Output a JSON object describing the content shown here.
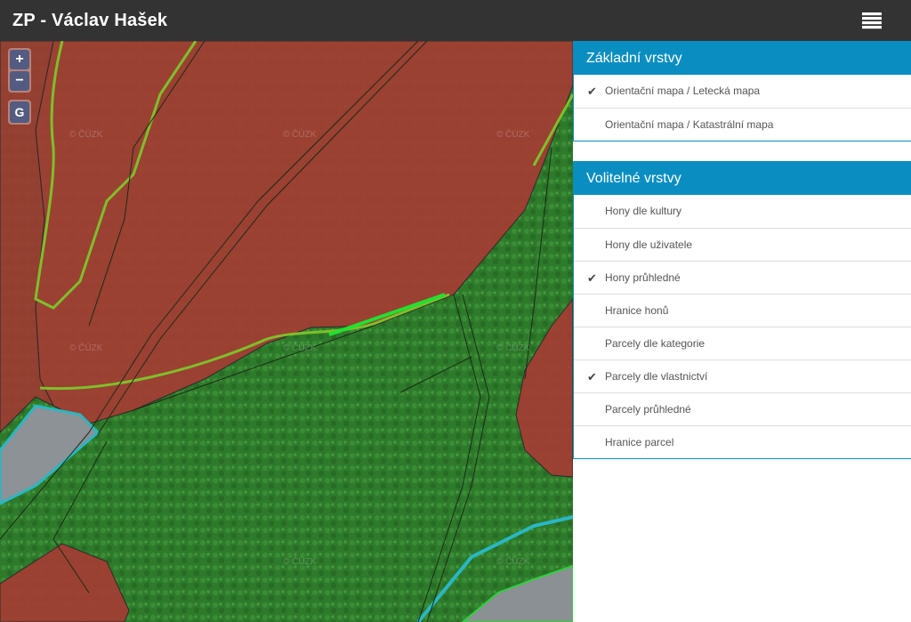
{
  "header": {
    "title": "ZP - Václav Hašek"
  },
  "map": {
    "zoom_in_label": "+",
    "zoom_out_label": "−",
    "geo_button_label": "G",
    "watermark": "© ČÚZK"
  },
  "base_layers": {
    "heading": "Základní vrstvy",
    "items": [
      {
        "label": "Orientační mapa / Letecká mapa",
        "checked": true
      },
      {
        "label": "Orientační mapa / Katastrální mapa",
        "checked": false
      }
    ]
  },
  "optional_layers": {
    "heading": "Volitelné vrstvy",
    "items": [
      {
        "label": "Hony dle kultury",
        "checked": false
      },
      {
        "label": "Hony dle uživatele",
        "checked": false
      },
      {
        "label": "Hony průhledné",
        "checked": true
      },
      {
        "label": "Hranice honů",
        "checked": false
      },
      {
        "label": "Parcely dle kategorie",
        "checked": false
      },
      {
        "label": "Parcely dle vlastnictví",
        "checked": true
      },
      {
        "label": "Parcely průhledné",
        "checked": false
      },
      {
        "label": "Hranice parcel",
        "checked": false
      }
    ]
  },
  "colors": {
    "header_bg": "#333333",
    "accent": "#0a8ec1",
    "field_red": "#a83a34",
    "forest_green": "#2f7a2c"
  },
  "icons": {
    "menu": "layers-stack-icon",
    "check": "check-icon"
  }
}
